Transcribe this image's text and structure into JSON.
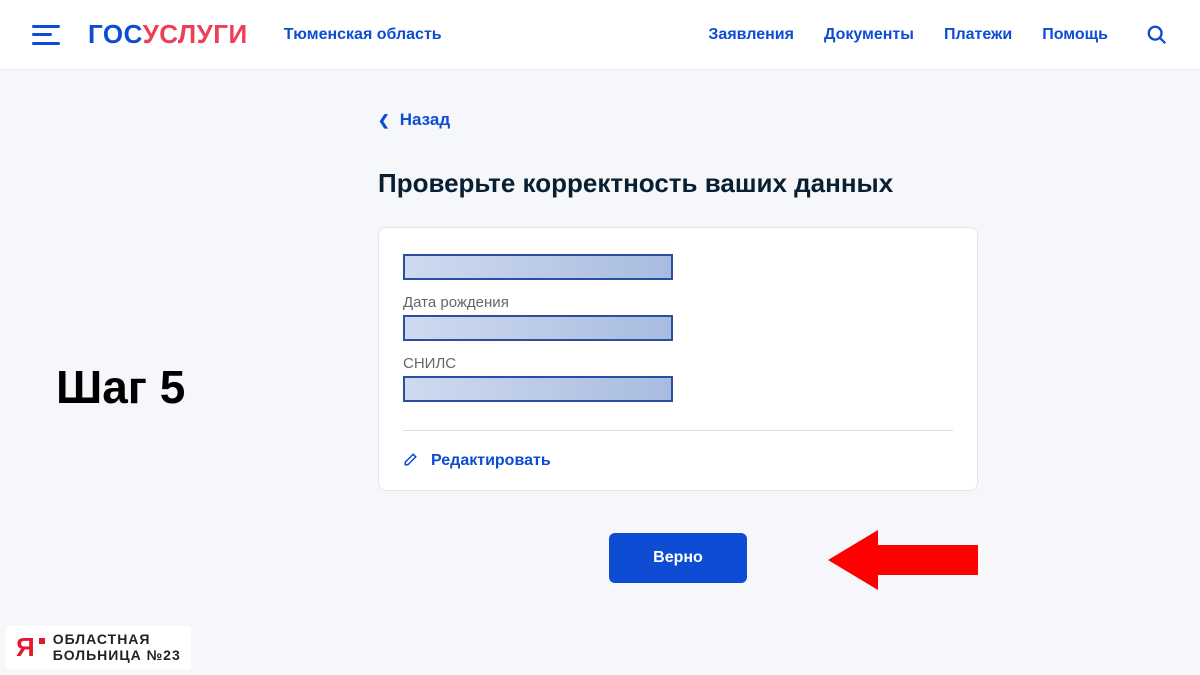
{
  "header": {
    "logo_part1": "гос",
    "logo_part2": "услуги",
    "region": "Тюменская область",
    "nav": [
      "Заявления",
      "Документы",
      "Платежи",
      "Помощь"
    ]
  },
  "annotation": {
    "step_label": "Шаг 5"
  },
  "page": {
    "back_label": "Назад",
    "heading": "Проверьте корректность ваших данных",
    "fields": {
      "dob_label": "Дата рождения",
      "snils_label": "СНИЛС"
    },
    "edit_label": "Редактировать",
    "submit_label": "Верно"
  },
  "hospital_logo": {
    "mark": "Я",
    "line1": "ОБЛАСТНАЯ",
    "line2": "БОЛЬНИЦА №23"
  }
}
